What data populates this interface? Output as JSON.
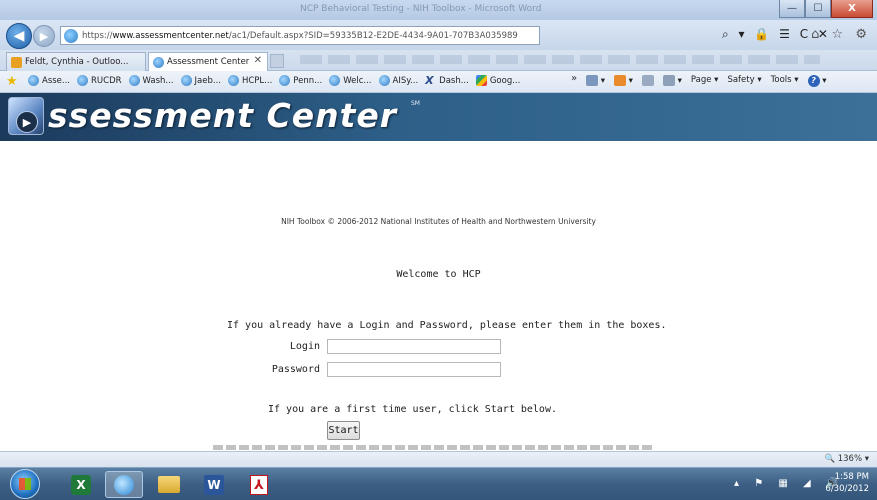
{
  "window": {
    "title": "NCP Behavioral Testing - NIH Toolbox - Microsoft Word",
    "minimize_glyph": "—",
    "maximize_glyph": "☐",
    "close_glyph": "X"
  },
  "address_bar": {
    "protocol": "https://",
    "domain": "www.assessmentcenter.net",
    "path": "/ac1/Default.aspx?SID=59335B12-E2DE-4434-9A01-707B3A035989",
    "tools": "⌕ ▾ 🔒 ☰ C ✕",
    "right_icons": "⌂ ☆ ⚙"
  },
  "tabs": [
    {
      "label": "Feldt, Cynthia - Outloo...",
      "icon": "outlook-icon",
      "active": false
    },
    {
      "label": "Assessment Center",
      "icon": "ie-icon",
      "active": true,
      "close": "✕"
    }
  ],
  "favorites": {
    "items": [
      {
        "label": "Asse...",
        "icon": "ie-icon"
      },
      {
        "label": "RUCDR",
        "icon": "ie-icon"
      },
      {
        "label": "Wash...",
        "icon": "ie-icon"
      },
      {
        "label": "Jaeb...",
        "icon": "ie-icon"
      },
      {
        "label": "HCPL...",
        "icon": "ie-icon"
      },
      {
        "label": "Penn...",
        "icon": "ie-icon"
      },
      {
        "label": "Welc...",
        "icon": "ie-icon"
      },
      {
        "label": "AISy...",
        "icon": "ie-icon"
      },
      {
        "label": "Dash...",
        "icon": "x-icon"
      },
      {
        "label": "Goog...",
        "icon": "google-icon"
      }
    ],
    "overflow": "»"
  },
  "command_bar": {
    "page": "Page ▾",
    "safety": "Safety ▾",
    "tools": "Tools ▾",
    "help": "?"
  },
  "banner": {
    "title": "ssessment Center",
    "sm": "SM"
  },
  "content": {
    "copyright": "NIH Toolbox © 2006-2012 National Institutes of Health and Northwestern University",
    "welcome": "Welcome to HCP",
    "instructions": "If you already have a Login and Password, please enter them in the boxes.",
    "login_label": "Login",
    "password_label": "Password",
    "login_value": "",
    "password_value": "",
    "first_time": "If you are a first time user, click Start below.",
    "start_label": "Start"
  },
  "status_bar": {
    "zoom": "🔍 136%  ▾"
  },
  "taskbar": {
    "apps": [
      "excel",
      "internet-explorer",
      "file-explorer",
      "word",
      "acrobat"
    ],
    "excel_glyph": "X",
    "word_glyph": "W",
    "pdf_glyph": "⅄",
    "tray": "▴ ⚑ ▦ ◢ 🔊",
    "time": "1:58 PM",
    "date": "6/30/2012"
  }
}
